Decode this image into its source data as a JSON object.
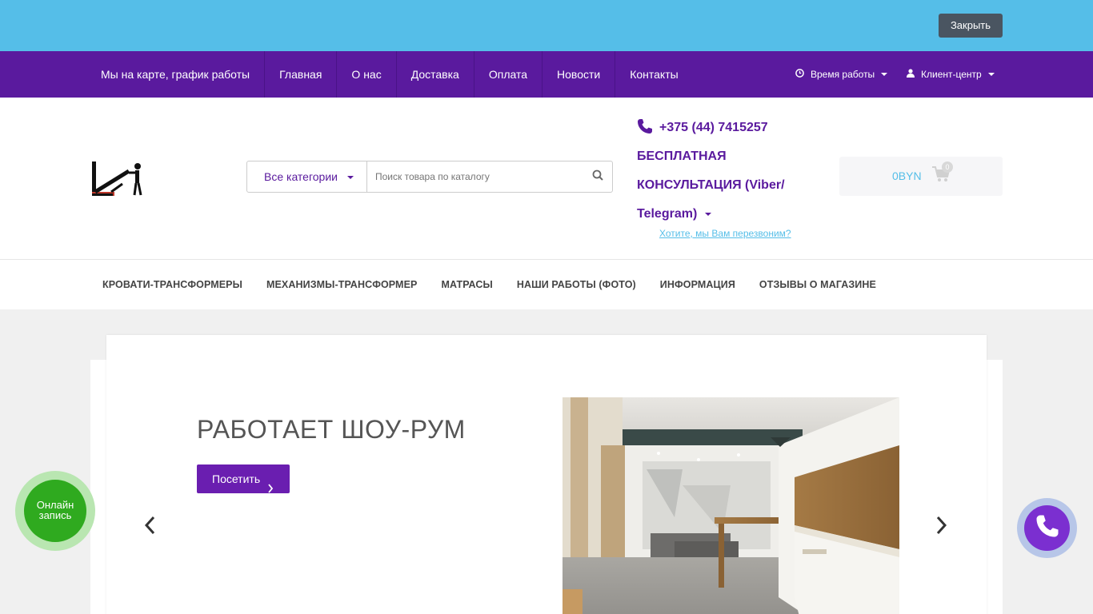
{
  "topbar": {
    "close_label": "Закрыть"
  },
  "nav": {
    "items": [
      "Мы на карте, график работы",
      "Главная",
      "О нас",
      "Доставка",
      "Оплата",
      "Новости",
      "Контакты"
    ],
    "work_hours": "Время работы",
    "client_center": "Клиент-центр"
  },
  "header": {
    "search": {
      "category_label": "Все категории",
      "placeholder": "Поиск товара по каталогу"
    },
    "phone": "+375 (44) 7415257",
    "consult_lines": [
      "БЕСПЛАТНАЯ",
      "КОНСУЛЬТАЦИЯ (Viber/",
      "Telegram)"
    ],
    "callback_link": "Хотите, мы Вам перезвоним?",
    "cart": {
      "total": "0BYN",
      "count": "0"
    }
  },
  "catmenu": {
    "items": [
      "КРОВАТИ-ТРАНСФОРМЕРЫ",
      "МЕХАНИЗМЫ-ТРАНСФОРМЕР",
      "МАТРАСЫ",
      "НАШИ РАБОТЫ (ФОТО)",
      "ИНФОРМАЦИЯ",
      "ОТЗЫВЫ О МАГАЗИНЕ"
    ]
  },
  "slider": {
    "title": "РАБОТАЕТ ШОУ-РУМ",
    "button_label": "Посетить"
  },
  "widgets": {
    "online_line1": "Онлайн",
    "online_line2": "запись"
  },
  "colors": {
    "accent": "#5a1a9e",
    "topbar": "#55bee8",
    "online": "#2faa1f",
    "call": "#7b2fd0"
  },
  "icons": [
    "clock-icon",
    "user-icon",
    "phone-icon",
    "search-icon",
    "cart-icon",
    "chevron-left-icon",
    "chevron-right-icon"
  ]
}
